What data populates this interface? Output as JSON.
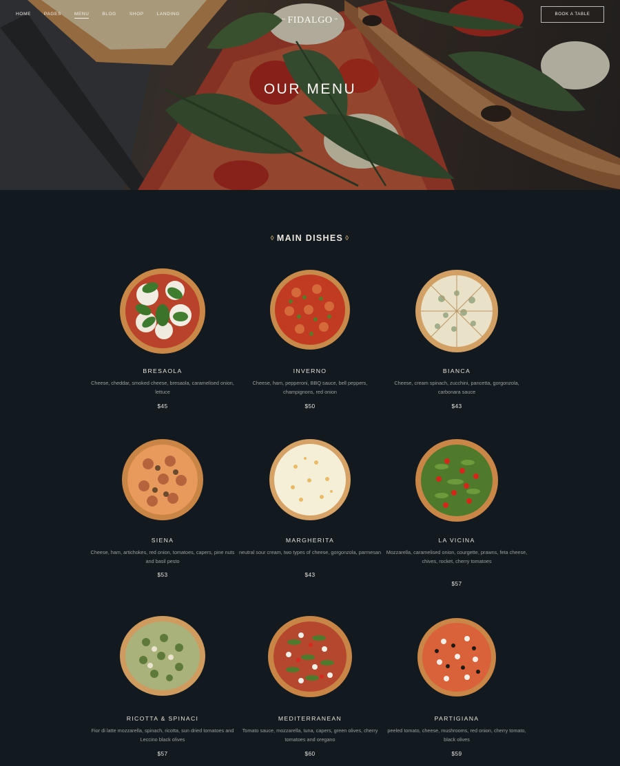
{
  "nav": {
    "items": [
      "HOME",
      "PAGES",
      "MENU",
      "BLOG",
      "SHOP",
      "LANDING"
    ],
    "active": "MENU"
  },
  "logo": {
    "text": "FIDALGO"
  },
  "book_button": "BOOK A TABLE",
  "hero": {
    "title": "OUR MENU"
  },
  "section": {
    "title": "MAIN DISHES"
  },
  "menu": [
    {
      "name": "BRESAOLA",
      "desc": "Cheese, cheddar, smoked cheese, bresaola, caramelised onion, lettuce",
      "price": "$45"
    },
    {
      "name": "INVERNO",
      "desc": "Cheese, ham, pepperoni, BBQ sauce, bell peppers, champignons, red onion",
      "price": "$50"
    },
    {
      "name": "BIANCA",
      "desc": "Cheese, cream spinach, zucchini, pancetta, gorgonzola, carbonara sauce",
      "price": "$43"
    },
    {
      "name": "SIENA",
      "desc": "Cheese, ham, artichokes, red onion, tomatoes, capers, pine nuts and basil pesto",
      "price": "$53"
    },
    {
      "name": "MARGHERITA",
      "desc": "neutral sour cream, two types of cheese, gorgonzola, parmesan",
      "price": "$43"
    },
    {
      "name": "LA VICINA",
      "desc": "Mozzarella, caramelised onion, courgette, prawns, feta cheese, chives, rocket, cherry tomatoes",
      "price": "$57"
    },
    {
      "name": "RICOTTA & SPINACI",
      "desc": "Fior di latte mozzarella, spinach, ricotta, sun dried tomatoes and Leccino black olives",
      "price": "$57"
    },
    {
      "name": "MEDITERRANEAN",
      "desc": "Tomato sauce, mozzarella, tuna, capers, green olives, cherry tomatoes and oregano",
      "price": "$60"
    },
    {
      "name": "PARTIGIANA",
      "desc": "peeled tomato, cheese, mushrooms, red onion, cherry tomato, black olives",
      "price": "$59"
    }
  ]
}
